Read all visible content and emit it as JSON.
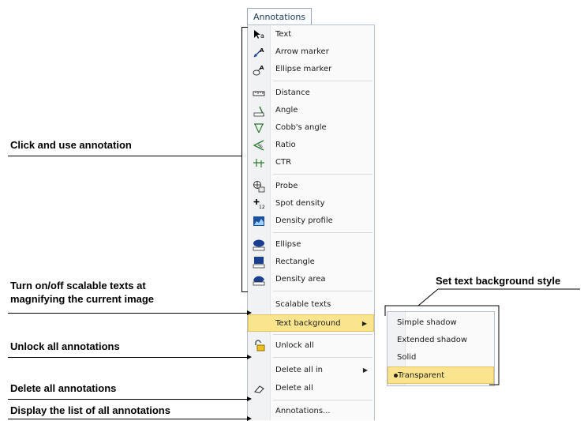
{
  "menu_title": "Annotations",
  "menu_items": [
    {
      "label": "Text",
      "icon": "text-cursor-icon"
    },
    {
      "label": "Arrow marker",
      "icon": "arrow-marker-icon"
    },
    {
      "label": "Ellipse marker",
      "icon": "ellipse-marker-icon"
    },
    {
      "label": "Distance",
      "icon": "ruler-icon"
    },
    {
      "label": "Angle",
      "icon": "angle-icon"
    },
    {
      "label": "Cobb's angle",
      "icon": "cobb-angle-icon"
    },
    {
      "label": "Ratio",
      "icon": "ratio-icon"
    },
    {
      "label": "CTR",
      "icon": "ctr-icon"
    },
    {
      "label": "Probe",
      "icon": "probe-icon"
    },
    {
      "label": "Spot density",
      "icon": "spot-density-icon"
    },
    {
      "label": "Density profile",
      "icon": "density-profile-icon"
    },
    {
      "label": "Ellipse",
      "icon": "ellipse-icon"
    },
    {
      "label": "Rectangle",
      "icon": "rectangle-icon"
    },
    {
      "label": "Density area",
      "icon": "density-area-icon"
    },
    {
      "label": "Scalable texts",
      "icon": ""
    },
    {
      "label": "Text background",
      "icon": "",
      "submenu": true,
      "highlighted": true
    },
    {
      "label": "Unlock all",
      "icon": "unlock-icon"
    },
    {
      "label": "Delete all in",
      "icon": "",
      "submenu": true
    },
    {
      "label": "Delete all",
      "icon": "eraser-icon"
    },
    {
      "label": "Annotations...",
      "icon": ""
    }
  ],
  "submenu_items": [
    {
      "label": "Simple shadow"
    },
    {
      "label": "Extended shadow"
    },
    {
      "label": "Solid"
    },
    {
      "label": "Transparent",
      "selected": true
    }
  ],
  "notes": {
    "click_use": "Click and use annotation",
    "scalable_line1": "Turn on/off scalable texts at",
    "scalable_line2": "magnifying the current image",
    "unlock": "Unlock all annotations",
    "delete": "Delete all annotations",
    "display": "Display the list of all annotations",
    "text_bg": "Set text background style"
  },
  "colors": {
    "highlight": "#fbe48e",
    "highlight_border": "#e5c365",
    "menu_border": "#b7c0cf"
  }
}
